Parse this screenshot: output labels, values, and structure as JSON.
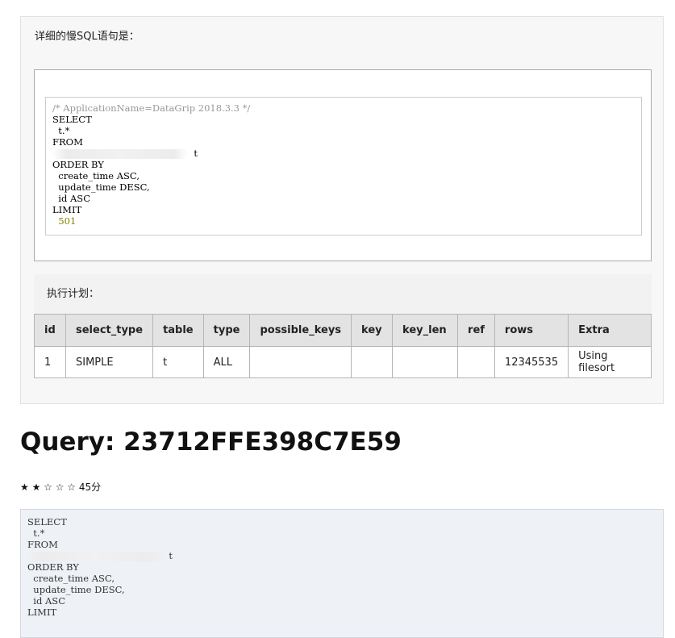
{
  "report": {
    "slow_sql_heading": "详细的慢SQL语句是：",
    "sql_lines": {
      "comment": "/* ApplicationName=DataGrip 2018.3.3 */",
      "select": "SELECT",
      "cols": "  t.*",
      "from": "FROM",
      "table_alias": "t",
      "order_by": "ORDER BY",
      "order1": "  create_time ASC,",
      "order2": "  update_time DESC,",
      "order3": "  id ASC",
      "limit": "LIMIT",
      "limit_value": "501"
    },
    "plan_heading": "执行计划：",
    "plan_columns": [
      "id",
      "select_type",
      "table",
      "type",
      "possible_keys",
      "key",
      "key_len",
      "ref",
      "rows",
      "Extra"
    ],
    "plan_row": [
      "1",
      "SIMPLE",
      "t",
      "ALL",
      "",
      "",
      "",
      "",
      "12345535",
      "Using filesort"
    ]
  },
  "query": {
    "title": "Query: 23712FFE398C7E59",
    "stars": "★ ★ ☆ ☆ ☆",
    "score": "45分",
    "score_fraction": 0.45,
    "sql_lines": {
      "select": "SELECT",
      "cols": "  t.*",
      "from": "FROM",
      "table_alias": "t",
      "order_by": "ORDER BY",
      "order1": "  create_time ASC,",
      "order2": "  update_time DESC,",
      "order3": "  id ASC",
      "limit": "LIMIT"
    }
  }
}
